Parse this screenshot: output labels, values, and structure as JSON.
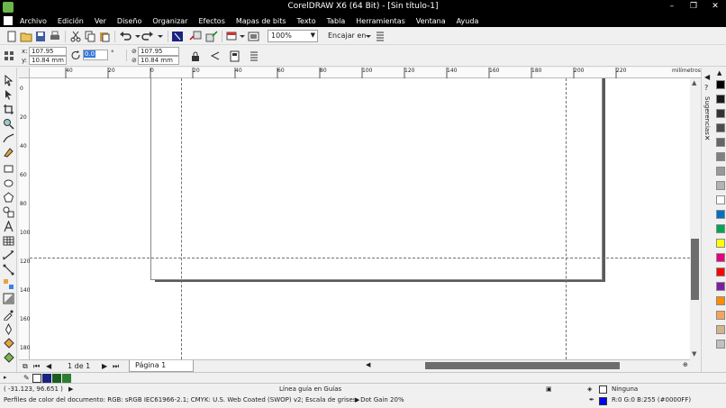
{
  "window": {
    "title": "CorelDRAW X6 (64 Bit) - [Sin título-1]"
  },
  "menu": [
    "Archivo",
    "Edición",
    "Ver",
    "Diseño",
    "Organizar",
    "Efectos",
    "Mapas de bits",
    "Texto",
    "Tabla",
    "Herramientas",
    "Ventana",
    "Ayuda"
  ],
  "toolbar": {
    "zoom": "100%",
    "snap": "Encajar en"
  },
  "properties": {
    "x_label": "x:",
    "y_label": "y:",
    "x": "107.95 mm",
    "y": "10.84 mm",
    "rotation": "0.0",
    "degree_symbol": "°",
    "w": "107.95 mm",
    "h": "10.84 mm"
  },
  "ruler": {
    "units": "milímetros",
    "h_ticks": [
      "40",
      "20",
      "0",
      "20",
      "40",
      "60",
      "80",
      "100",
      "120",
      "140",
      "160",
      "180",
      "200",
      "220"
    ],
    "v_ticks": [
      "0",
      "20",
      "40",
      "60",
      "80",
      "100",
      "120",
      "140",
      "160",
      "180"
    ]
  },
  "docker": {
    "label": "Sugerencias"
  },
  "page_nav": {
    "counter": "1 de 1",
    "tab": "Página 1"
  },
  "status": {
    "cursor": "( -31.123, 96.651 )",
    "object_info": "Línea guía en Guías",
    "fill": "Ninguna",
    "outline": "R:0 G:0 B:255 (#0000FF)",
    "color_profiles": "Perfiles de color del documento: RGB: sRGB IEC61966-2.1; CMYK: U.S. Web Coated (SWOP) v2; Escala de grises: Dot Gain 20%"
  },
  "colors": {
    "outline_swatch": "#0000ff",
    "palette": [
      "#000000",
      "#1a1a1a",
      "#333333",
      "#4d4d4d",
      "#666666",
      "#808080",
      "#999999",
      "#b3b3b3",
      "#ffffff",
      "#0070c0",
      "#00a651",
      "#ffff00",
      "#e6007e",
      "#ff0000",
      "#7b1fa2",
      "#ff8c00",
      "#f4a460",
      "#d2b48c",
      "#c0c0c0"
    ]
  }
}
